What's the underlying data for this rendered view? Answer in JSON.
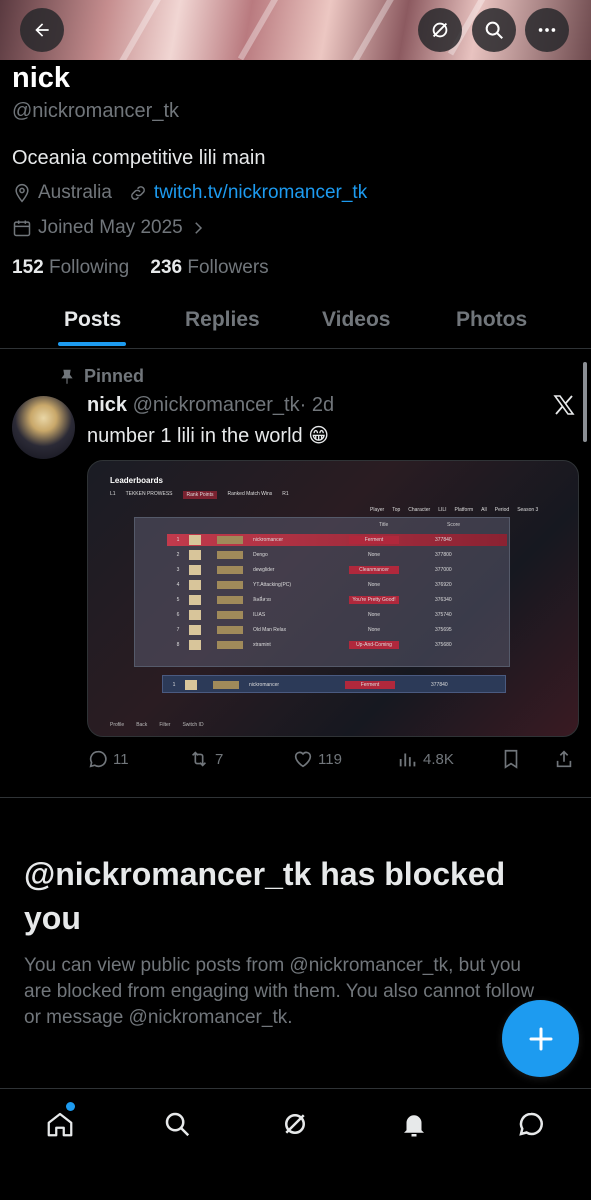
{
  "profile": {
    "name": "nick",
    "handle": "@nickromancer_tk",
    "bio": "Oceania competitive lili main",
    "location": "Australia",
    "link": "twitch.tv/nickromancer_tk",
    "joined": "Joined May 2025",
    "following_count": "152",
    "following_label": "Following",
    "followers_count": "236",
    "followers_label": "Followers"
  },
  "tabs": [
    {
      "label": "Posts"
    },
    {
      "label": "Replies"
    },
    {
      "label": "Videos"
    },
    {
      "label": "Photos"
    }
  ],
  "post": {
    "pinned_label": "Pinned",
    "author_name": "nick",
    "author_handle": "@nickromancer_tk",
    "time": "· 2d",
    "text": "number 1 lili in the world 😁",
    "media": {
      "title": "Leaderboards",
      "tabs": [
        "L1",
        "TEKKEN PROWESS",
        "Rank Points",
        "Ranked Match Wins",
        "R1"
      ],
      "filters": [
        "Player",
        "Top",
        "Character",
        "LILI",
        "Platform",
        "All",
        "Period",
        "Season 3"
      ],
      "columns": [
        "Title",
        "Score"
      ],
      "rows": [
        {
          "rank": "1",
          "name": "nickromancer",
          "title": "Ferment",
          "score": "377840"
        },
        {
          "rank": "2",
          "name": "Dengo",
          "title": "None",
          "score": "377800"
        },
        {
          "rank": "3",
          "name": "dewglider",
          "title": "Cleanmancer",
          "score": "377000"
        },
        {
          "rank": "4",
          "name": "YT.Attacking(PC)",
          "title": "None",
          "score": "376920"
        },
        {
          "rank": "5",
          "name": "ลิลลี่สวย",
          "title": "You're Pretty Good!",
          "score": "376340"
        },
        {
          "rank": "6",
          "name": "ILIAS",
          "title": "None",
          "score": "375740"
        },
        {
          "rank": "7",
          "name": "Old Man Relax",
          "title": "None",
          "score": "375695"
        },
        {
          "rank": "8",
          "name": "xtramint",
          "title": "Up-And-Coming",
          "score": "375680"
        }
      ],
      "self_row": {
        "rank": "1",
        "name": "nickromancer",
        "title": "Ferment",
        "score": "377840"
      },
      "bottom": [
        "Profile",
        "Back",
        "Filter",
        "Switch ID"
      ]
    },
    "replies": "11",
    "reposts": "7",
    "likes": "119",
    "views": "4.8K"
  },
  "blocked": {
    "title": "@nickromancer_tk has blocked you",
    "body": "You can view public posts from @nickromancer_tk, but you are blocked from engaging with them. You also cannot follow or message @nickromancer_tk."
  },
  "icons": {
    "back": "back-arrow-icon",
    "grok": "grok-icon",
    "search": "search-icon",
    "more": "more-icon",
    "location": "location-icon",
    "link": "link-icon",
    "calendar": "calendar-icon",
    "pin": "pin-icon",
    "x": "x-logo-icon",
    "compose": "plus-icon",
    "nav_home": "home-icon",
    "nav_search": "search-icon",
    "nav_grok": "grok-icon",
    "nav_notifications": "bell-icon",
    "nav_messages": "chat-icon"
  },
  "colors": {
    "accent": "#1d9bf0",
    "background": "#000000",
    "muted": "#71767b",
    "text": "#e7e9ea"
  }
}
